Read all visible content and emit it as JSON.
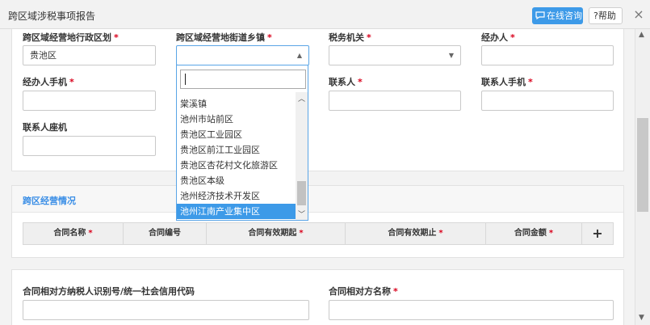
{
  "dialog": {
    "title": "跨区域涉税事项报告",
    "consult_label": "在线咨询",
    "help_label": "帮助",
    "close_glyph": "×"
  },
  "form": {
    "admin_region_label": "跨区域经营地行政区划",
    "admin_region_value": "贵池区",
    "street_label": "跨区域经营地街道乡镇",
    "street_value": "",
    "tax_office_label": "税务机关",
    "agent_label": "经办人",
    "agent_phone_label": "经办人手机",
    "contact_label": "联系人",
    "contact_phone_label": "联系人手机",
    "contact_landline_label": "联系人座机",
    "required_mark": "*"
  },
  "dropdown": {
    "search_value": "",
    "items": [
      "棠溪镇",
      "池州市站前区",
      "贵池区工业园区",
      "贵池区前江工业园区",
      "贵池区杏花村文化旅游区",
      "贵池区本级",
      "池州经济技术开发区",
      "池州江南产业集中区"
    ],
    "selected_index": 7
  },
  "section": {
    "title": "跨区经营情况",
    "columns": [
      "合同名称",
      "合同编号",
      "合同有效期起",
      "合同有效期止",
      "合同金额"
    ],
    "required_columns": [
      0,
      2,
      3,
      4
    ],
    "add_glyph": "+"
  },
  "counterparty": {
    "taxpayer_id_label": "合同相对方纳税人识别号/统一社会信用代码",
    "name_label": "合同相对方名称"
  }
}
